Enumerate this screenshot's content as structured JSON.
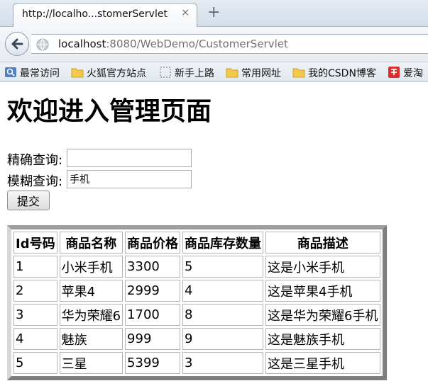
{
  "browser": {
    "tab_title": "http://localho...stomerServlet",
    "tab_close": "×",
    "new_tab": "+",
    "url_host": "localhost",
    "url_rest": ":8080/WebDemo/CustomerServlet",
    "bookmarks": [
      {
        "label": "最常访问",
        "icon": "bookmarks-toolbar-icon"
      },
      {
        "label": "火狐官方站点",
        "icon": "folder-icon"
      },
      {
        "label": "新手上路",
        "icon": "page-icon"
      },
      {
        "label": "常用网址",
        "icon": "folder-icon"
      },
      {
        "label": "我的CSDN博客",
        "icon": "folder-icon"
      },
      {
        "label": "爱淘",
        "icon": "taobao-icon"
      }
    ]
  },
  "page": {
    "heading": "欢迎进入管理页面",
    "exact_label": "精确查询:",
    "exact_value": "",
    "fuzzy_label": "模糊查询:",
    "fuzzy_value": "手机",
    "submit_label": "提交"
  },
  "table": {
    "headers": [
      "Id号码",
      "商品名称",
      "商品价格",
      "商品库存数量",
      "商品描述"
    ],
    "rows": [
      [
        "1",
        "小米手机",
        "3300",
        "5",
        "这是小米手机"
      ],
      [
        "2",
        "苹果4",
        "2999",
        "4",
        "这是苹果4手机"
      ],
      [
        "3",
        "华为荣耀6",
        "1700",
        "8",
        "这是华为荣耀6手机"
      ],
      [
        "4",
        "魅族",
        "999",
        "9",
        "这是魅族手机"
      ],
      [
        "5",
        "三星",
        "5399",
        "3",
        "这是三星手机"
      ]
    ]
  },
  "colors": {
    "taobao_icon": "#e02c2c",
    "folder_icon": "#f2c94c"
  }
}
